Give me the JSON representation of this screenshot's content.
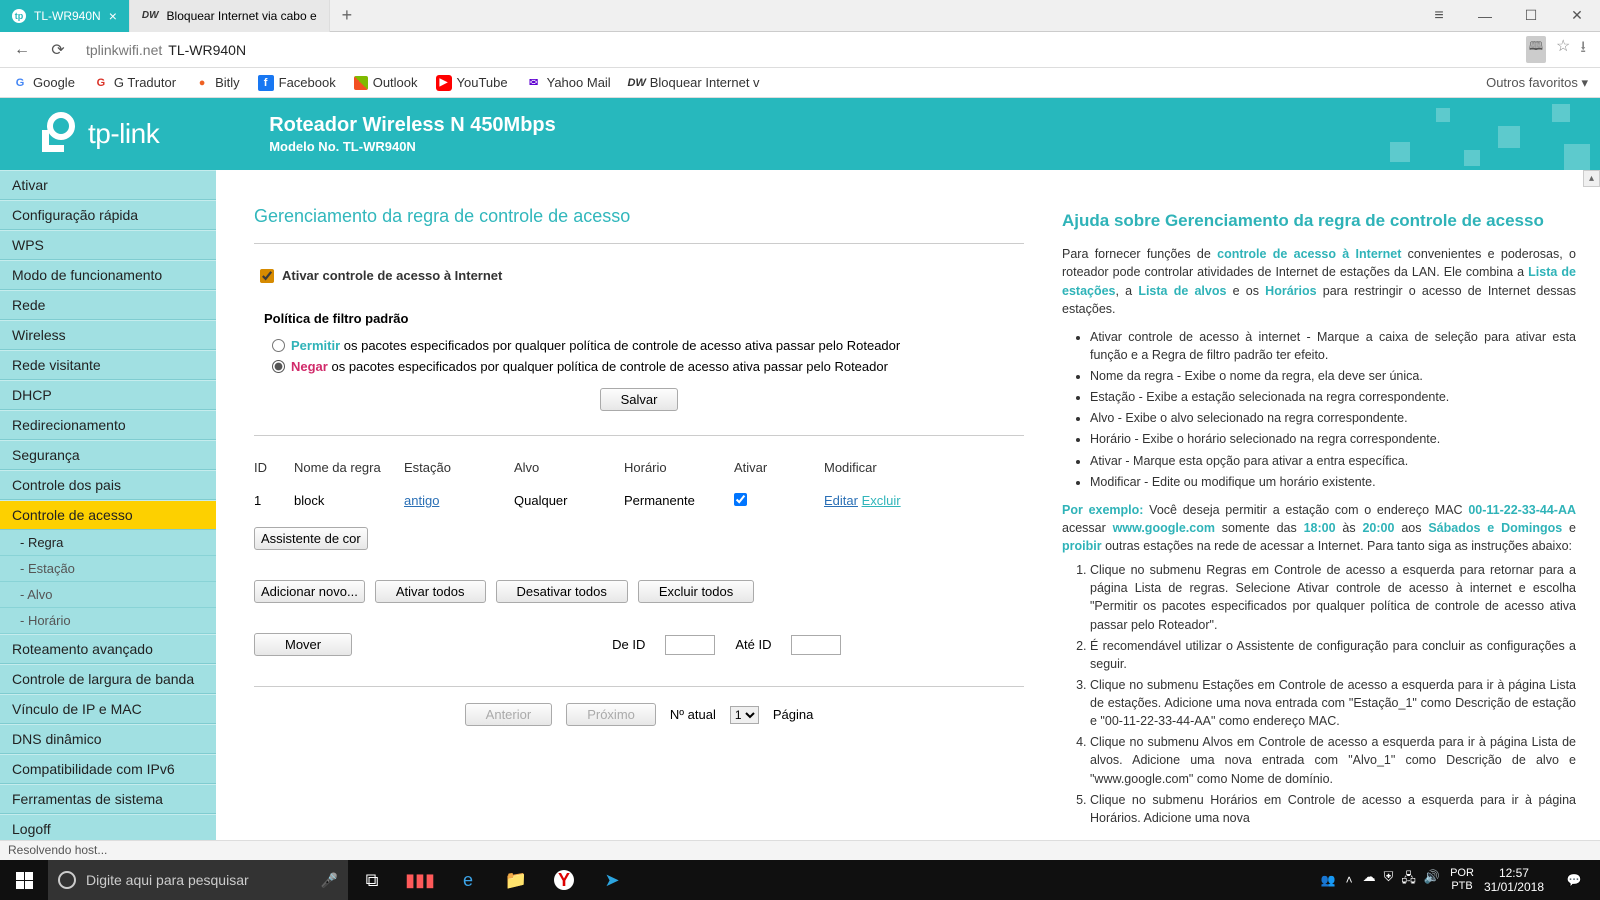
{
  "browser": {
    "tabs": [
      {
        "favicon": "tp",
        "title": "TL-WR940N",
        "active": true
      },
      {
        "favicon": "dw",
        "title": "Bloquear Internet via cabo e",
        "active": false
      }
    ],
    "url_host": "tplinkwifi.net",
    "url_path": "TL-WR940N",
    "bookmarks": [
      {
        "icon": "G",
        "cls": "bm-g",
        "label": "Google"
      },
      {
        "icon": "G",
        "cls": "bm-gt",
        "label": "G Tradutor"
      },
      {
        "icon": "●",
        "cls": "bm-b",
        "label": "Bitly"
      },
      {
        "icon": "f",
        "cls": "bm-f",
        "label": "Facebook"
      },
      {
        "icon": "⊞",
        "cls": "bm-o",
        "label": "Outlook"
      },
      {
        "icon": "▶",
        "cls": "bm-y",
        "label": "YouTube"
      },
      {
        "icon": "✉",
        "cls": "bm-ym",
        "label": "Yahoo Mail"
      },
      {
        "icon": "DW",
        "cls": "bm-dw",
        "label": "Bloquear Internet v"
      }
    ],
    "other_fav": "Outros favoritos ▾"
  },
  "banner": {
    "brand": "tp-link",
    "title": "Roteador Wireless N 450Mbps",
    "model": "Modelo No. TL-WR940N"
  },
  "sidebar": {
    "items": [
      "Ativar",
      "Configuração rápida",
      "WPS",
      "Modo de funcionamento",
      "Rede",
      "Wireless",
      "Rede visitante",
      "DHCP",
      "Redirecionamento",
      "Segurança",
      "Controle dos pais",
      "Controle de acesso"
    ],
    "subs": [
      "- Regra",
      "- Estação",
      "- Alvo",
      "- Horário"
    ],
    "items2": [
      "Roteamento avançado",
      "Controle de largura de banda",
      "Vínculo de IP e MAC",
      "DNS dinâmico",
      "Compatibilidade com IPv6",
      "Ferramentas de sistema",
      "Logoff"
    ]
  },
  "content": {
    "title": "Gerenciamento da regra de controle de acesso",
    "enable_label": "Ativar controle de acesso à Internet",
    "policy_title": "Política de filtro padrão",
    "allow_word": "Permitir",
    "allow_rest": " os pacotes especificados por qualquer política de controle de acesso ativa passar pelo Roteador",
    "deny_word": "Negar",
    "deny_rest": " os pacotes especificados por qualquer política de controle de acesso ativa passar pelo Roteador",
    "save": "Salvar",
    "headers": {
      "id": "ID",
      "name": "Nome da regra",
      "station": "Estação",
      "target": "Alvo",
      "schedule": "Horário",
      "enable": "Ativar",
      "modify": "Modificar"
    },
    "row": {
      "id": "1",
      "name": "block",
      "station": "antigo",
      "target": "Qualquer",
      "schedule": "Permanente",
      "edit": "Editar",
      "del": "Excluir"
    },
    "assistant": "Assistente de cor",
    "btns": {
      "add": "Adicionar novo...",
      "enable_all": "Ativar todos",
      "disable_all": "Desativar todos",
      "delete_all": "Excluir todos"
    },
    "move": "Mover",
    "from_id": "De ID",
    "to_id": "Até ID",
    "prev": "Anterior",
    "next": "Próximo",
    "page_curr_label": "Nº atual",
    "page_curr_val": "1",
    "page_word": "Página"
  },
  "help": {
    "title": "Ajuda sobre Gerenciamento da regra de controle de acesso",
    "intro_1": "Para fornecer funções de ",
    "intro_link1": "controle de acesso à Internet",
    "intro_2": " convenientes e poderosas, o roteador pode controlar atividades de Internet de estações da LAN. Ele combina a ",
    "intro_link2": "Lista de estações",
    "intro_3": ", a ",
    "intro_link3": "Lista de alvos",
    "intro_4": " e os ",
    "intro_link4": "Horários",
    "intro_5": " para restringir o acesso de Internet dessas estações.",
    "bullets": [
      "Ativar controle de acesso à internet - Marque a caixa de seleção para ativar esta função e a Regra de filtro padrão ter efeito.",
      "Nome da regra - Exibe o nome da regra, ela deve ser única.",
      "Estação - Exibe a estação selecionada na regra correspondente.",
      "Alvo - Exibe o alvo selecionado na regra correspondente.",
      "Horário - Exibe o horário selecionado na regra correspondente.",
      "Ativar - Marque esta opção para ativar a entra específica.",
      "Modificar - Edite ou modifique um horário existente."
    ],
    "example_label": "Por exemplo:",
    "example_1": " Você deseja permitir a estação com o endereço MAC ",
    "mac": "00-11-22-33-44-AA",
    "example_2": " acessar ",
    "site": "www.google.com",
    "example_3": " somente das ",
    "t1": "18:00",
    "example_4": " às ",
    "t2": "20:00",
    "example_5": " aos ",
    "days": "Sábados e Domingos",
    "example_6": " e ",
    "proibir": "proibir",
    "example_7": " outras estações na rede de acessar a Internet. Para tanto siga as instruções abaixo:",
    "steps": [
      "Clique no submenu Regras em Controle de acesso a esquerda para retornar para a página Lista de regras. Selecione Ativar controle de acesso à internet e escolha \"Permitir os pacotes especificados por qualquer política de controle de acesso ativa passar pelo Roteador\".",
      "É recomendável utilizar o Assistente de configuração para concluir as configurações a seguir.",
      "Clique no submenu Estações em Controle de acesso a esquerda para ir à página Lista de estações. Adicione uma nova entrada com \"Estação_1\" como Descrição de estação e \"00-11-22-33-44-AA\" como endereço MAC.",
      "Clique no submenu Alvos em Controle de acesso a esquerda para ir à página Lista de alvos. Adicione uma nova entrada com \"Alvo_1\" como Descrição de alvo e \"www.google.com\" como Nome de domínio.",
      "Clique no submenu Horários em Controle de acesso a esquerda para ir à página Horários. Adicione uma nova"
    ]
  },
  "status": "Resolvendo host...",
  "taskbar": {
    "search_placeholder": "Digite aqui para pesquisar",
    "lang1": "POR",
    "lang2": "PTB",
    "time": "12:57",
    "date": "31/01/2018"
  }
}
